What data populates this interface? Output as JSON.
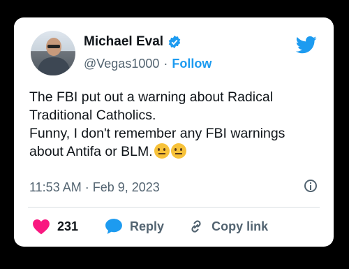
{
  "user": {
    "name": "Michael Eval",
    "handle": "@Vegas1000",
    "separator": "·",
    "follow": "Follow"
  },
  "tweet": {
    "lines": [
      "The FBI put out a warning about Radical",
      "Traditional Catholics.",
      "Funny, I don't remember any FBI warnings",
      "about Antifa or BLM."
    ],
    "emojis": [
      "thinking-face-emoji",
      "face-with-raised-eyebrow-emoji"
    ],
    "timestamp": "11:53 AM · Feb 9, 2023"
  },
  "actions": {
    "likes": "231",
    "reply": "Reply",
    "copy": "Copy link"
  },
  "colors": {
    "accent": "#1d9bf0",
    "like": "#f91880",
    "text": "#0f1419",
    "muted": "#536471"
  }
}
